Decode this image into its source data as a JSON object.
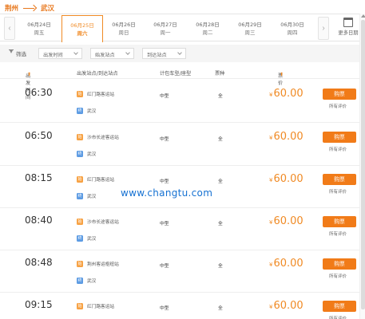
{
  "route": {
    "from": "荆州",
    "to": "武汉"
  },
  "dates": [
    {
      "date": "06月24日",
      "weekday": "周五"
    },
    {
      "date": "06月25日",
      "weekday": "周六",
      "active": true
    },
    {
      "date": "06月26日",
      "weekday": "周日"
    },
    {
      "date": "06月27日",
      "weekday": "周一"
    },
    {
      "date": "06月28日",
      "weekday": "周二"
    },
    {
      "date": "06月29日",
      "weekday": "周三"
    },
    {
      "date": "06月30日",
      "weekday": "周四"
    }
  ],
  "more_dates": "更多日期",
  "filters": {
    "label": "筛选",
    "time": "出发时间",
    "depart_station": "始发站点",
    "arrive_station": "到达站点"
  },
  "headers": {
    "time": "出发时间",
    "stations": "出发站点/到达站点",
    "vehicle": "计包车型/座型",
    "ticket": "票种",
    "price": "票价"
  },
  "rows": [
    {
      "time": "06:30",
      "from": "红门路客运站",
      "to": "武汉",
      "vehicle": "中型",
      "ticket": "全",
      "price": "60.00",
      "button": "购票",
      "reviews": "所有评价"
    },
    {
      "time": "06:50",
      "from": "沙市长途客运站",
      "to": "武汉",
      "vehicle": "中型",
      "ticket": "全",
      "price": "60.00",
      "button": "购票",
      "reviews": "所有评价"
    },
    {
      "time": "08:15",
      "from": "红门路客运站",
      "to": "武汉",
      "vehicle": "中型",
      "ticket": "全",
      "price": "60.00",
      "button": "购票",
      "reviews": "所有评价"
    },
    {
      "time": "08:40",
      "from": "沙市长途客运站",
      "to": "武汉",
      "vehicle": "中型",
      "ticket": "全",
      "price": "60.00",
      "button": "购票",
      "reviews": "所有评价"
    },
    {
      "time": "08:48",
      "from": "荆州客运枢纽站",
      "to": "武汉",
      "vehicle": "中型",
      "ticket": "全",
      "price": "60.00",
      "button": "购票",
      "reviews": "所有评价"
    },
    {
      "time": "09:15",
      "from": "红门路客运站",
      "to": "武汉",
      "vehicle": "中型",
      "ticket": "全",
      "price": "60.00",
      "button": "购票",
      "reviews": "所有评价"
    }
  ],
  "badges": {
    "from": "始",
    "to": "终"
  },
  "watermark": "www.changtu.com"
}
